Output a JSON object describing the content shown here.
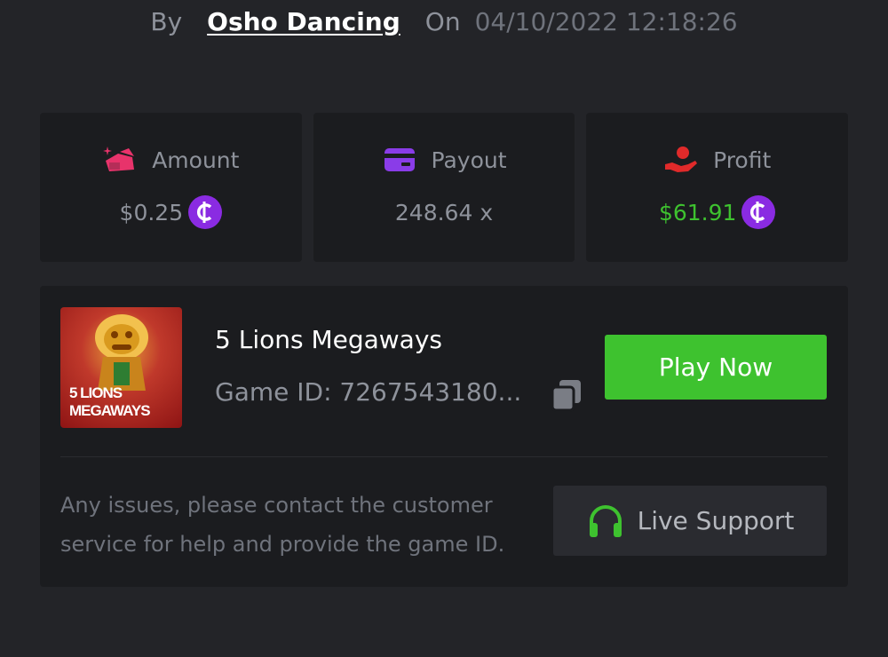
{
  "byline": {
    "by": "By",
    "author": "Osho Dancing",
    "on": "On",
    "datetime": "04/10/2022 12:18:26"
  },
  "stats": {
    "amount": {
      "label": "Amount",
      "value": "$0.25",
      "icon": "wallet-icon"
    },
    "payout": {
      "label": "Payout",
      "value": "248.64 x",
      "icon": "card-icon"
    },
    "profit": {
      "label": "Profit",
      "value": "$61.91",
      "icon": "hand-coin-icon"
    }
  },
  "coin_symbol": "₵",
  "game": {
    "title": "5 Lions Megaways",
    "id_text": "Game ID: 7267543180...",
    "thumb_line1": "5 LIONS",
    "thumb_line2": "MEGAWAYS",
    "play_label": "Play Now"
  },
  "support": {
    "help_text": "Any issues, please contact the customer service for help and provide the game ID.",
    "button_label": "Live Support"
  },
  "colors": {
    "background": "#232428",
    "card": "#1b1c1f",
    "accent_green": "#3ec22f",
    "coin_purple": "#8a2be2",
    "amount_pink": "#e8336b",
    "payout_purple": "#8a3ce8",
    "profit_red": "#e02a2a"
  }
}
